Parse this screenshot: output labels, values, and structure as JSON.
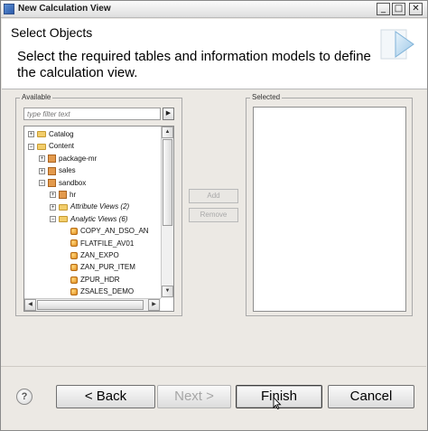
{
  "window": {
    "title": "New Calculation View",
    "controls": {
      "minimize": "_",
      "maximize": "□",
      "close": "✕"
    }
  },
  "header": {
    "title": "Select Objects",
    "description": "Select the required tables and information models to define the calculation view.",
    "icon": "wizard-arrow-icon"
  },
  "available": {
    "label": "Available",
    "search_placeholder": "type filter text",
    "search_button": "▶",
    "tree": [
      {
        "label": "Catalog",
        "level": 0,
        "expander": "+",
        "icon": "folder-icon"
      },
      {
        "label": "Content",
        "level": 0,
        "expander": "−",
        "icon": "folder-icon"
      },
      {
        "label": "package-mr",
        "level": 1,
        "expander": "+",
        "icon": "package-icon"
      },
      {
        "label": "sales",
        "level": 1,
        "expander": "+",
        "icon": "package-icon"
      },
      {
        "label": "sandbox",
        "level": 1,
        "expander": "−",
        "icon": "package-icon"
      },
      {
        "label": "hr",
        "level": 2,
        "expander": "+",
        "icon": "package-icon"
      },
      {
        "label": "Attribute Views (2)",
        "level": 2,
        "expander": "+",
        "icon": "folder-icon",
        "italic": true
      },
      {
        "label": "Analytic Views (6)",
        "level": 2,
        "expander": "−",
        "icon": "folder-icon",
        "italic": true
      },
      {
        "label": "COPY_AN_DSO_AN",
        "level": 3,
        "icon": "analytic-view-icon"
      },
      {
        "label": "FLATFILE_AV01",
        "level": 3,
        "icon": "analytic-view-icon"
      },
      {
        "label": "ZAN_EXPO",
        "level": 3,
        "icon": "analytic-view-icon"
      },
      {
        "label": "ZAN_PUR_ITEM",
        "level": 3,
        "icon": "analytic-view-icon"
      },
      {
        "label": "ZPUR_HDR",
        "level": 3,
        "icon": "analytic-view-icon"
      },
      {
        "label": "ZSALES_DEMO",
        "level": 3,
        "icon": "analytic-view-icon"
      }
    ]
  },
  "actions": {
    "add": "Add",
    "remove": "Remove"
  },
  "selected": {
    "label": "Selected",
    "items": []
  },
  "footer": {
    "help": "?",
    "back": "< Back",
    "next": "Next >",
    "finish": "Finish",
    "cancel": "Cancel"
  },
  "colors": {
    "dialog_bg": "#ece9e4",
    "disabled_text": "#a6a6a6",
    "folder": "#f2cd6a",
    "analytic_view": "#e08a1c"
  }
}
